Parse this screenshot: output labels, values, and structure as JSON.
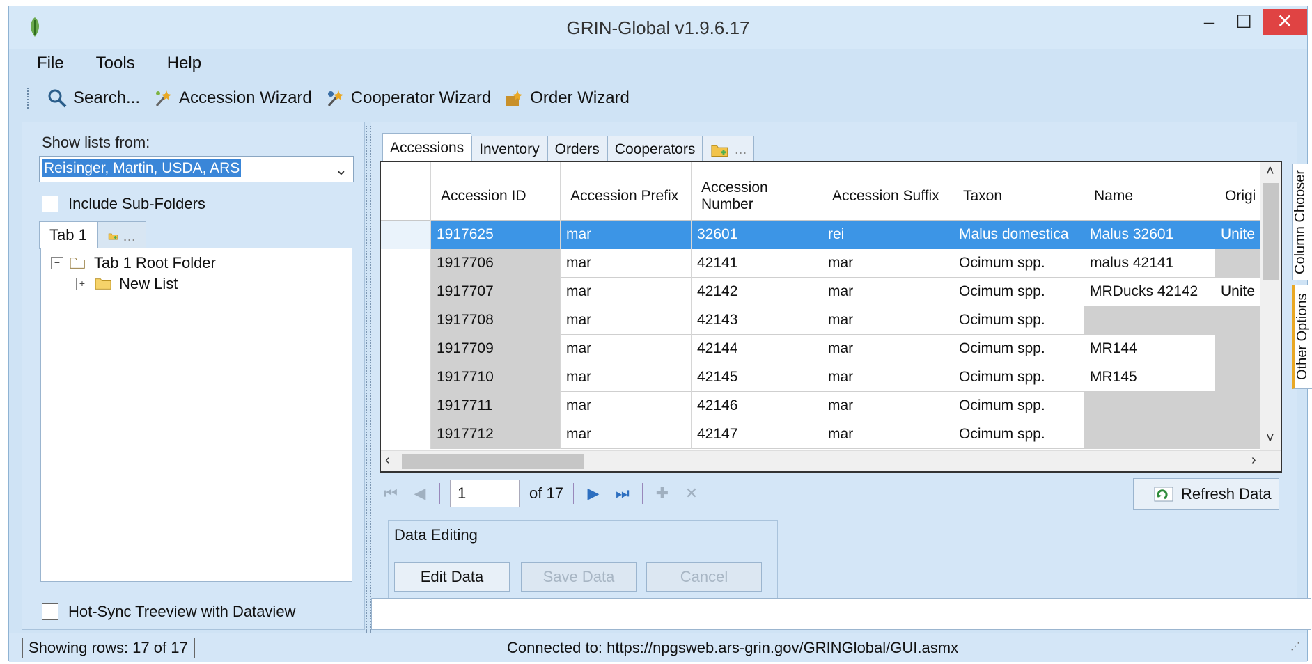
{
  "window": {
    "title": "GRIN-Global v1.9.6.17",
    "minimize": "–",
    "maximize": "☐",
    "close": "✕"
  },
  "menu": [
    "File",
    "Tools",
    "Help"
  ],
  "toolbar": {
    "search": "Search...",
    "accession_wizard": "Accession Wizard",
    "cooperator_wizard": "Cooperator Wizard",
    "order_wizard": "Order Wizard"
  },
  "left": {
    "show_lists_label": "Show lists from:",
    "owner_selected": "Reisinger, Martin, USDA, ARS",
    "include_subfolders": "Include Sub-Folders",
    "tab1": "Tab 1",
    "add_tab": "...",
    "tree_root": "Tab 1 Root Folder",
    "tree_child": "New List",
    "hot_sync": "Hot-Sync Treeview with Dataview"
  },
  "tabs": {
    "accessions": "Accessions",
    "inventory": "Inventory",
    "orders": "Orders",
    "cooperators": "Cooperators",
    "add": "..."
  },
  "grid": {
    "headers": [
      "Accession ID",
      "Accession Prefix",
      "Accession Number",
      "Accession Suffix",
      "Taxon",
      "Name",
      "Origi"
    ],
    "rows": [
      [
        "1917625",
        "mar",
        "32601",
        "rei",
        "Malus domestica",
        "Malus 32601",
        "Unite"
      ],
      [
        "1917706",
        "mar",
        "42141",
        "mar",
        "Ocimum spp.",
        "malus 42141",
        ""
      ],
      [
        "1917707",
        "mar",
        "42142",
        "mar",
        "Ocimum spp.",
        "MRDucks 42142",
        "Unite"
      ],
      [
        "1917708",
        "mar",
        "42143",
        "mar",
        "Ocimum spp.",
        "",
        ""
      ],
      [
        "1917709",
        "mar",
        "42144",
        "mar",
        "Ocimum spp.",
        "MR144",
        ""
      ],
      [
        "1917710",
        "mar",
        "42145",
        "mar",
        "Ocimum spp.",
        "MR145",
        ""
      ],
      [
        "1917711",
        "mar",
        "42146",
        "mar",
        "Ocimum spp.",
        "",
        ""
      ],
      [
        "1917712",
        "mar",
        "42147",
        "mar",
        "Ocimum spp.",
        "",
        ""
      ]
    ]
  },
  "navigator": {
    "position": "1",
    "of_total": "of 17"
  },
  "refresh": "Refresh Data",
  "data_editing": {
    "legend": "Data Editing",
    "edit": "Edit Data",
    "save": "Save Data",
    "cancel": "Cancel"
  },
  "side_tabs": {
    "column_chooser": "Column Chooser",
    "other_options": "Other Options"
  },
  "status": {
    "rows": "Showing rows: 17 of 17",
    "connected": "Connected to: https://npgsweb.ars-grin.gov/GRINGlobal/GUI.asmx"
  },
  "colors": {
    "selection": "#3c95e6",
    "window_bg": "#d4e6f7",
    "close_button": "#e04343"
  }
}
